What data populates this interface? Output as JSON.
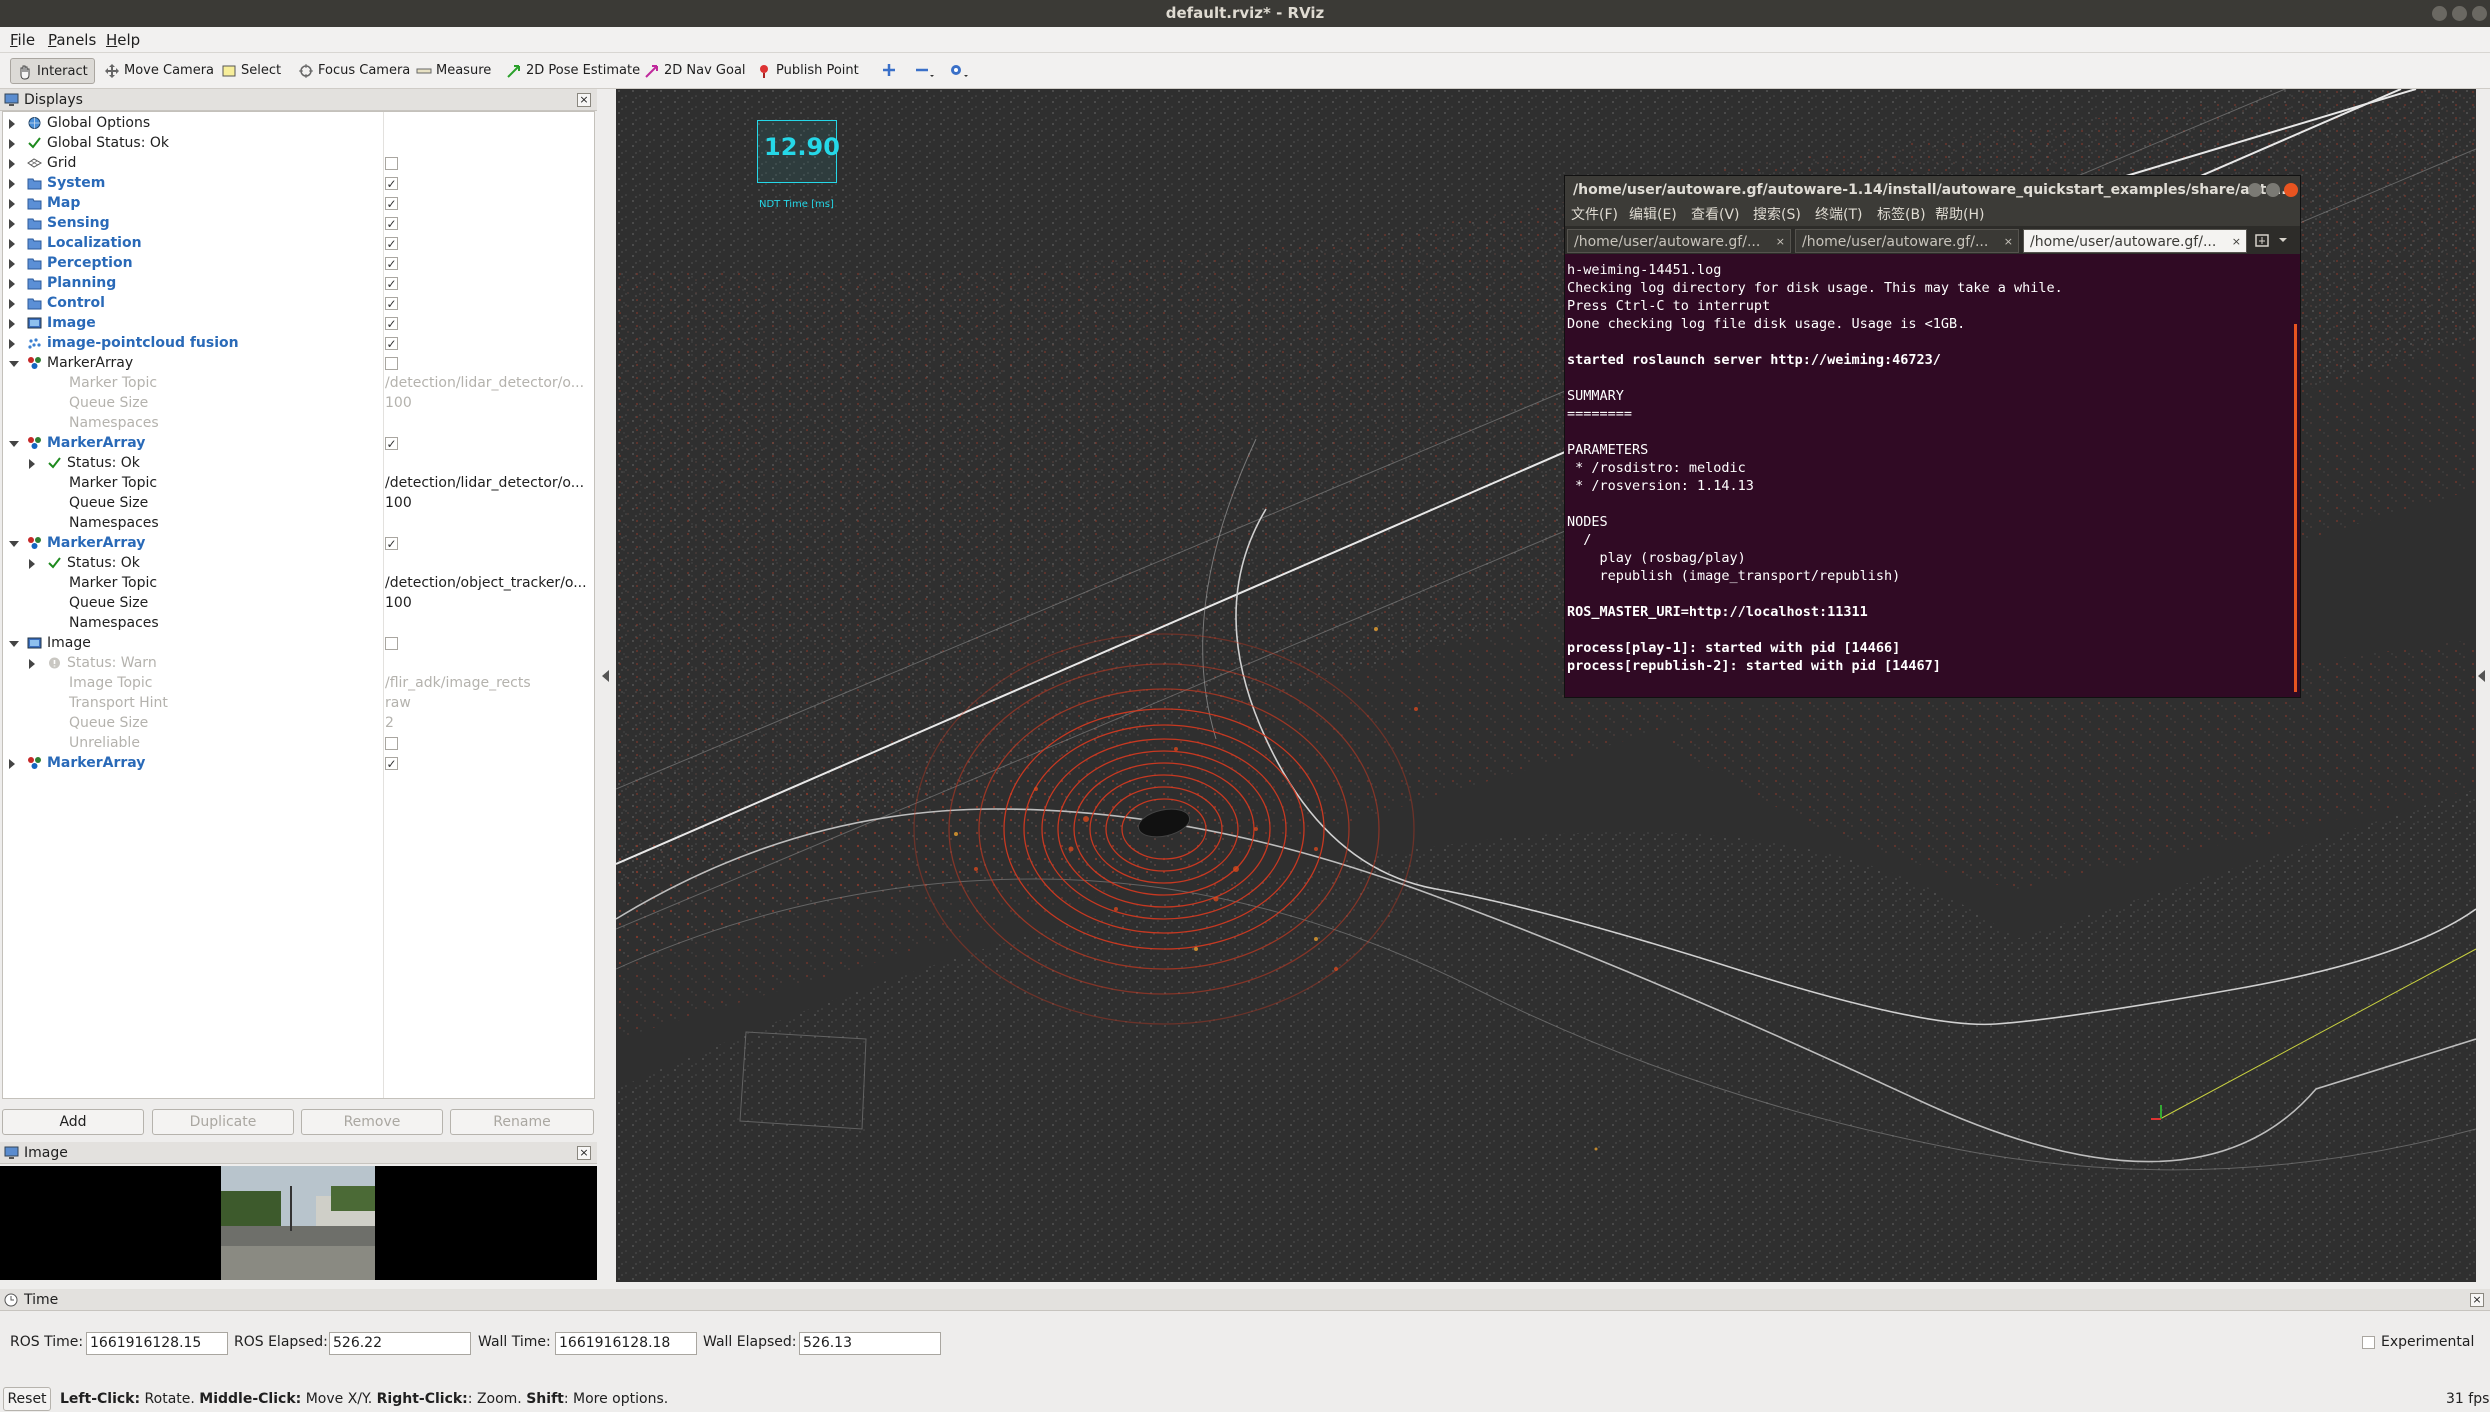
{
  "window": {
    "title": "default.rviz* - RViz"
  },
  "menubar": {
    "items": [
      "File",
      "Panels",
      "Help"
    ]
  },
  "toolbar": {
    "tools": [
      {
        "label": "Interact",
        "icon": "hand-icon",
        "active": true
      },
      {
        "label": "Move Camera",
        "icon": "move-camera-icon"
      },
      {
        "label": "Select",
        "icon": "select-icon"
      },
      {
        "label": "Focus Camera",
        "icon": "focus-icon"
      },
      {
        "label": "Measure",
        "icon": "ruler-icon"
      },
      {
        "label": "2D Pose Estimate",
        "icon": "green-arrow-icon"
      },
      {
        "label": "2D Nav Goal",
        "icon": "pink-arrow-icon"
      },
      {
        "label": "Publish Point",
        "icon": "pin-icon"
      }
    ]
  },
  "displays": {
    "title": "Displays",
    "rows": [
      {
        "label": "Global Options",
        "indent": 0,
        "arrow": "closed",
        "icon": "globe-icon"
      },
      {
        "label": "Global Status: Ok",
        "indent": 0,
        "arrow": "closed",
        "icon": "check-icon"
      },
      {
        "label": "Grid",
        "indent": 0,
        "arrow": "closed",
        "icon": "grid-icon",
        "check": false
      },
      {
        "label": "System",
        "indent": 0,
        "arrow": "closed",
        "icon": "folder-icon",
        "style": "blue",
        "check": true
      },
      {
        "label": "Map",
        "indent": 0,
        "arrow": "closed",
        "icon": "folder-icon",
        "style": "blue",
        "check": true
      },
      {
        "label": "Sensing",
        "indent": 0,
        "arrow": "closed",
        "icon": "folder-icon",
        "style": "blue",
        "check": true
      },
      {
        "label": "Localization",
        "indent": 0,
        "arrow": "closed",
        "icon": "folder-icon",
        "style": "blue",
        "check": true
      },
      {
        "label": "Perception",
        "indent": 0,
        "arrow": "closed",
        "icon": "folder-icon",
        "style": "blue",
        "check": true
      },
      {
        "label": "Planning",
        "indent": 0,
        "arrow": "closed",
        "icon": "folder-icon",
        "style": "blue",
        "check": true
      },
      {
        "label": "Control",
        "indent": 0,
        "arrow": "closed",
        "icon": "folder-icon",
        "style": "blue",
        "check": true
      },
      {
        "label": "Image",
        "indent": 0,
        "arrow": "closed",
        "icon": "image-icon",
        "style": "blue",
        "check": true
      },
      {
        "label": "image-pointcloud fusion",
        "indent": 0,
        "arrow": "closed",
        "icon": "pointcloud-icon",
        "style": "blue",
        "check": true
      },
      {
        "label": "MarkerArray",
        "indent": 0,
        "arrow": "open",
        "icon": "marker-icon",
        "check": false
      },
      {
        "label": "Marker Topic",
        "indent": 1,
        "style": "grey",
        "value": "/detection/lidar_detector/o...",
        "valstyle": "grey"
      },
      {
        "label": "Queue Size",
        "indent": 1,
        "style": "grey",
        "value": "100",
        "valstyle": "grey"
      },
      {
        "label": "Namespaces",
        "indent": 1,
        "style": "grey"
      },
      {
        "label": "MarkerArray",
        "indent": 0,
        "arrow": "open",
        "icon": "marker-icon",
        "style": "blue",
        "check": true
      },
      {
        "label": "Status: Ok",
        "indent": 1,
        "arrow": "closed",
        "icon": "check-icon"
      },
      {
        "label": "Marker Topic",
        "indent": 1,
        "value": "/detection/lidar_detector/o..."
      },
      {
        "label": "Queue Size",
        "indent": 1,
        "value": "100"
      },
      {
        "label": "Namespaces",
        "indent": 1
      },
      {
        "label": "MarkerArray",
        "indent": 0,
        "arrow": "open",
        "icon": "marker-icon",
        "style": "blue",
        "check": true
      },
      {
        "label": "Status: Ok",
        "indent": 1,
        "arrow": "closed",
        "icon": "check-icon"
      },
      {
        "label": "Marker Topic",
        "indent": 1,
        "value": "/detection/object_tracker/o..."
      },
      {
        "label": "Queue Size",
        "indent": 1,
        "value": "100"
      },
      {
        "label": "Namespaces",
        "indent": 1
      },
      {
        "label": "Image",
        "indent": 0,
        "arrow": "open",
        "icon": "image-icon",
        "check": false
      },
      {
        "label": "Status: Warn",
        "indent": 1,
        "arrow": "closed",
        "icon": "warn-icon",
        "style": "grey"
      },
      {
        "label": "Image Topic",
        "indent": 1,
        "style": "grey",
        "value": "/flir_adk/image_rects",
        "valstyle": "grey"
      },
      {
        "label": "Transport Hint",
        "indent": 1,
        "style": "grey",
        "value": "raw",
        "valstyle": "grey"
      },
      {
        "label": "Queue Size",
        "indent": 1,
        "style": "grey",
        "value": "2",
        "valstyle": "grey"
      },
      {
        "label": "Unreliable",
        "indent": 1,
        "style": "grey",
        "check": false
      },
      {
        "label": "MarkerArray",
        "indent": 0,
        "arrow": "closed",
        "icon": "marker-icon",
        "style": "blue",
        "check": true
      }
    ],
    "buttons": {
      "add": "Add",
      "duplicate": "Duplicate",
      "remove": "Remove",
      "rename": "Rename"
    }
  },
  "image_panel": {
    "title": "Image"
  },
  "viewport": {
    "overlay_value": "12.90",
    "overlay_label": "NDT Time [ms]"
  },
  "terminal": {
    "title": "/home/user/autoware.gf/autoware-1.14/install/autoware_quickstart_examples/share/auto...",
    "menu": [
      "文件(F)",
      "编辑(E)",
      "查看(V)",
      "搜索(S)",
      "终端(T)",
      "标签(B)",
      "帮助(H)"
    ],
    "tabs": [
      "/home/user/autoware.gf/...",
      "/home/user/autoware.gf/...",
      "/home/user/autoware.gf/..."
    ],
    "lines": [
      {
        "t": "h-weiming-14451.log"
      },
      {
        "t": "Checking log directory for disk usage. This may take a while."
      },
      {
        "t": "Press Ctrl-C to interrupt"
      },
      {
        "t": "Done checking log file disk usage. Usage is <1GB."
      },
      {
        "t": ""
      },
      {
        "t": "started roslaunch server http://weiming:46723/",
        "b": true
      },
      {
        "t": ""
      },
      {
        "t": "SUMMARY"
      },
      {
        "t": "========"
      },
      {
        "t": ""
      },
      {
        "t": "PARAMETERS"
      },
      {
        "t": " * /rosdistro: melodic"
      },
      {
        "t": " * /rosversion: 1.14.13"
      },
      {
        "t": ""
      },
      {
        "t": "NODES"
      },
      {
        "t": "  /"
      },
      {
        "t": "    play (rosbag/play)"
      },
      {
        "t": "    republish (image_transport/republish)"
      },
      {
        "t": ""
      },
      {
        "t": "ROS_MASTER_URI=http://localhost:11311",
        "b": true
      },
      {
        "t": ""
      },
      {
        "t": "process[play-1]: started with pid [14466]",
        "b": true
      },
      {
        "t": "process[republish-2]: started with pid [14467]",
        "b": true
      }
    ]
  },
  "time_panel": {
    "title": "Time",
    "ros_time_label": "ROS Time:",
    "ros_time": "1661916128.15",
    "ros_elapsed_label": "ROS Elapsed:",
    "ros_elapsed": "526.22",
    "wall_time_label": "Wall Time:",
    "wall_time": "1661916128.18",
    "wall_elapsed_label": "Wall Elapsed:",
    "wall_elapsed": "526.13",
    "experimental_label": "Experimental"
  },
  "statusbar": {
    "reset": "Reset",
    "left_click": "Left-Click:",
    "left_click_desc": " Rotate. ",
    "middle_click": "Middle-Click:",
    "middle_click_desc": " Move X/Y. ",
    "right_click": "Right-Click:",
    "right_click_desc": ": Zoom. ",
    "shift": "Shift",
    "shift_desc": ": More options.",
    "fps": "31 fps"
  },
  "colors": {
    "accent": "#e95420",
    "terminal_bg": "#300a24",
    "overlay": "#25d8e8",
    "lidar": "#d83a20"
  }
}
